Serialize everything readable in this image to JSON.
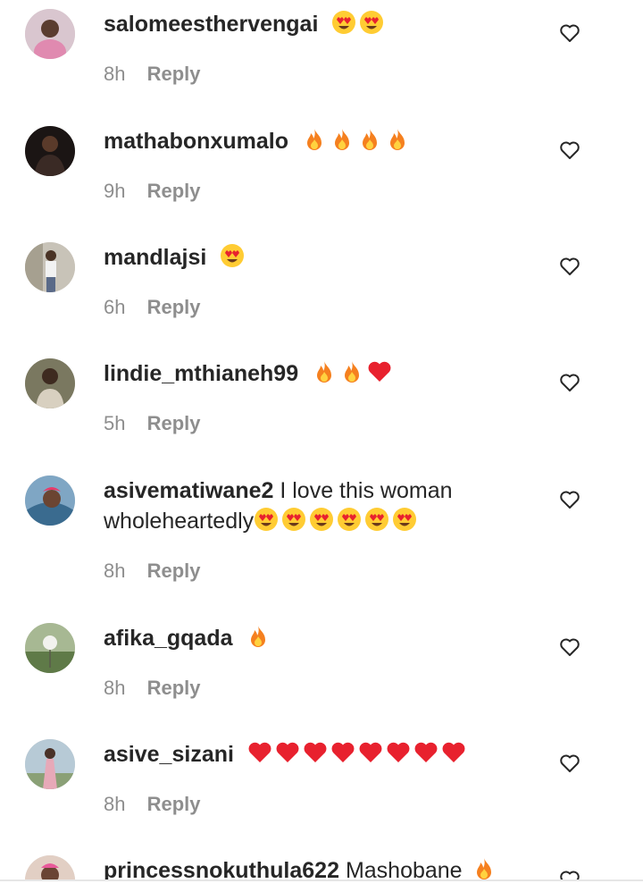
{
  "comments": [
    {
      "username": "salomeesthervengai",
      "text": "",
      "emoji": [
        "heart-eyes",
        "heart-eyes"
      ],
      "time": "8h",
      "reply_label": "Reply",
      "avatar_color": "#c9a5b5"
    },
    {
      "username": "mathabonxumalo",
      "text": "",
      "emoji": [
        "fire",
        "fire",
        "fire",
        "fire"
      ],
      "time": "9h",
      "reply_label": "Reply",
      "avatar_color": "#2b2523"
    },
    {
      "username": "mandlajsi",
      "text": "",
      "emoji": [
        "heart-eyes"
      ],
      "time": "6h",
      "reply_label": "Reply",
      "avatar_color": "#b8b2a7"
    },
    {
      "username": "lindie_mthianeh99",
      "text": "",
      "emoji": [
        "fire",
        "fire",
        "red-heart"
      ],
      "time": "5h",
      "reply_label": "Reply",
      "avatar_color": "#6b6a53"
    },
    {
      "username": "asivematiwane2",
      "text": "I love this woman wholeheartedly",
      "emoji": [
        "heart-eyes",
        "heart-eyes",
        "heart-eyes",
        "heart-eyes",
        "heart-eyes",
        "heart-eyes"
      ],
      "time": "8h",
      "reply_label": "Reply",
      "avatar_color": "#5c86a6"
    },
    {
      "username": "afika_gqada",
      "text": "",
      "emoji": [
        "fire"
      ],
      "time": "8h",
      "reply_label": "Reply",
      "avatar_color": "#7b8f62"
    },
    {
      "username": "asive_sizani",
      "text": "",
      "emoji": [
        "red-heart",
        "red-heart",
        "red-heart",
        "red-heart",
        "red-heart",
        "red-heart",
        "red-heart",
        "red-heart"
      ],
      "time": "8h",
      "reply_label": "Reply",
      "avatar_color": "#9ab3c4"
    },
    {
      "username": "princessnokuthula622",
      "text": "Mashobane",
      "emoji": [
        "fire"
      ],
      "time": "",
      "reply_label": "",
      "avatar_color": "#d1b7a5"
    }
  ],
  "colors": {
    "text": "#262626",
    "secondary": "#8e8e8e",
    "fire": "#f5801f",
    "heart": "#e8212e"
  }
}
